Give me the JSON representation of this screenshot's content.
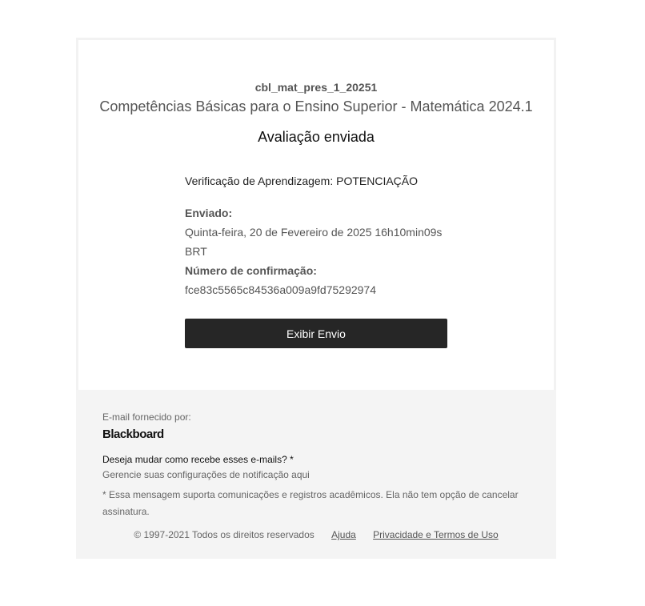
{
  "header": {
    "course_code": "cbl_mat_pres_1_20251",
    "course_name": "Competências Básicas para o Ensino Superior - Matemática 2024.1",
    "status": "Avaliação enviada"
  },
  "details": {
    "assessment": "Verificação de Aprendizagem: POTENCIAÇÃO",
    "sent_label": "Enviado:",
    "sent_value": "Quinta-feira, 20 de Fevereiro de 2025 16h10min09s",
    "sent_tz": "BRT",
    "confirmation_label": "Número de confirmação:",
    "confirmation_value": "fce83c5565c84536a009a9fd75292974",
    "view_button": "Exibir Envio"
  },
  "footer": {
    "provided_by": "E-mail fornecido por:",
    "logo": "Blackboard",
    "change_question": "Deseja mudar como recebe esses e-mails? *",
    "manage_link": "Gerencie suas configurações de notificação aqui",
    "note": "* Essa mensagem suporta comunicações e registros acadêmicos. Ela não tem opção de cancelar assinatura.",
    "copyright": "© 1997-2021 Todos os direitos reservados",
    "help": "Ajuda",
    "privacy": "Privacidade e Termos de Uso"
  }
}
